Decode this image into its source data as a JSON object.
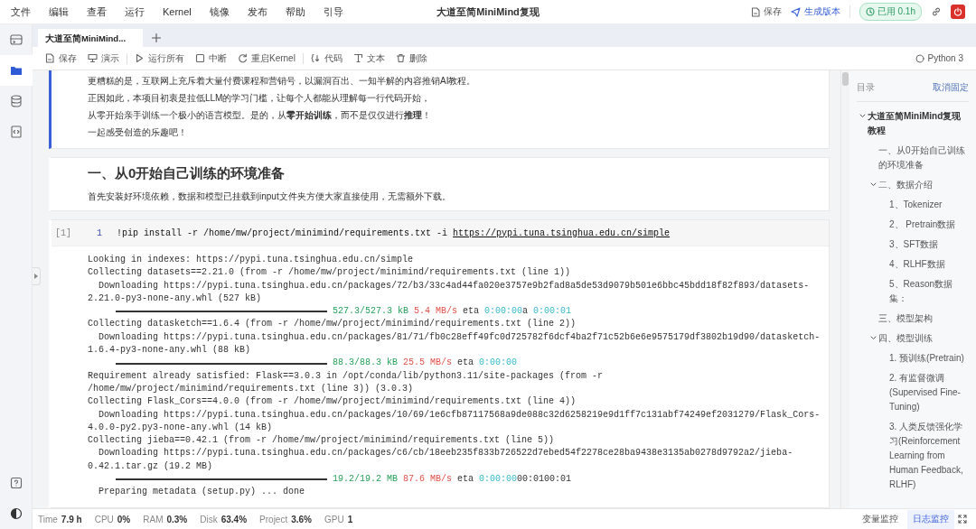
{
  "menu": [
    "文件",
    "编辑",
    "查看",
    "运行",
    "Kernel",
    "镜像",
    "发布",
    "帮助",
    "引导"
  ],
  "window": {
    "title": "大道至简MiniMind复现"
  },
  "header_actions": {
    "save": "保存",
    "publish": "生成版本",
    "usage": "已用 0.1h"
  },
  "rail": [
    {
      "selected": false
    },
    {
      "selected": true
    },
    {
      "selected": false
    },
    {
      "selected": false
    }
  ],
  "tabs": [
    {
      "label": "大道至简MiniMind...",
      "selected": true
    }
  ],
  "toolbar": {
    "groups": [
      [
        "保存",
        "演示"
      ],
      [
        "运行所有",
        "中断",
        "重启Kernel"
      ],
      [
        "代码",
        "文本",
        "删除"
      ]
    ],
    "kernel": "Python 3"
  },
  "cells": [
    {
      "kind": "markdown",
      "selected": true,
      "paragraphs": [
        "更糟糕的是，互联网上充斥着大量付费课程和营销号，以漏洞百出、一知半解的内容推销AI教程。",
        "正因如此，本项目初衷是拉低LLM的学习门槛，让每个人都能从理解每一行代码开始，",
        "从零开始亲手训练一个极小的语言模型。是的，从**零开始训练**，而不是仅仅进行**推理**！",
        "一起感受创造的乐趣吧！"
      ]
    },
    {
      "kind": "markdown",
      "selected": false,
      "heading": "一、从0开始自己训练的环境准备",
      "paragraphs": [
        "首先安装好环境依赖，数据和模型已挂载到input文件夹方便大家直接使用，无需额外下载。"
      ]
    },
    {
      "kind": "code",
      "selected": false,
      "prompt": "[1]",
      "line_number": "1",
      "code": "!pip install -r /home/mw/project/minimind/requirements.txt -i ",
      "code_link": "https://pypi.tuna.tsinghua.edu.cn/simple",
      "output": [
        {
          "kind": "text",
          "text": "Looking in indexes: https://pypi.tuna.tsinghua.edu.cn/simple"
        },
        {
          "kind": "text",
          "text": "Collecting datasets==2.21.0 (from -r /home/mw/project/minimind/requirements.txt (line 1))"
        },
        {
          "kind": "text",
          "text": "  Downloading https://pypi.tuna.tsinghua.edu.cn/packages/72/b3/33c4ad44fa020e3757e9b2fad8a5de53d9079b501e6bbc45bdd18f82f893/datasets-"
        },
        {
          "kind": "text",
          "text": "2.21.0-py3-none-any.whl (527 kB)"
        },
        {
          "kind": "progress",
          "level": 1,
          "parts": [
            {
              "kind": "size",
              "text": "527.3/527.3 kB"
            },
            {
              "kind": "rate",
              "text": "5.4 MB/s"
            },
            {
              "kind": "plain",
              "text": "eta"
            },
            {
              "kind": "eta",
              "text": "0:00:00"
            },
            {
              "kind": "glued",
              "text": "a"
            },
            {
              "kind": "eta",
              "text": "0:00:01"
            }
          ]
        },
        {
          "kind": "text",
          "text": "Collecting datasketch==1.6.4 (from -r /home/mw/project/minimind/requirements.txt (line 2))"
        },
        {
          "kind": "text",
          "text": "  Downloading https://pypi.tuna.tsinghua.edu.cn/packages/81/71/fb0c28eff49fc0d725782f6dcf4ba2f71c52b6e6e9575179df3802b19d90/datasketch-"
        },
        {
          "kind": "text",
          "text": "1.6.4-py3-none-any.whl (88 kB)"
        },
        {
          "kind": "progress",
          "level": 1,
          "parts": [
            {
              "kind": "size",
              "text": "88.3/88.3 kB"
            },
            {
              "kind": "rate",
              "text": "25.5 MB/s"
            },
            {
              "kind": "plain",
              "text": "eta"
            },
            {
              "kind": "eta",
              "text": "0:00:00"
            }
          ]
        },
        {
          "kind": "text",
          "text": "Requirement already satisfied: Flask==3.0.3 in /opt/conda/lib/python3.11/site-packages (from -r"
        },
        {
          "kind": "text",
          "text": "/home/mw/project/minimind/requirements.txt (line 3)) (3.0.3)"
        },
        {
          "kind": "text",
          "text": "Collecting Flask_Cors==4.0.0 (from -r /home/mw/project/minimind/requirements.txt (line 4))"
        },
        {
          "kind": "text",
          "text": "  Downloading https://pypi.tuna.tsinghua.edu.cn/packages/10/69/1e6cfb87117568a9de088c32d6258219e9d1ff7c131abf74249ef2031279/Flask_Cors-"
        },
        {
          "kind": "text",
          "text": "4.0.0-py2.py3-none-any.whl (14 kB)"
        },
        {
          "kind": "text",
          "text": "Collecting jieba==0.42.1 (from -r /home/mw/project/minimind/requirements.txt (line 5))"
        },
        {
          "kind": "text",
          "text": "  Downloading https://pypi.tuna.tsinghua.edu.cn/packages/c6/cb/18eeb235f833b726522d7ebed54f2278ce28ba9438e3135ab0278d9792a2/jieba-"
        },
        {
          "kind": "text",
          "text": "0.42.1.tar.gz (19.2 MB)"
        },
        {
          "kind": "progress",
          "level": 1,
          "parts": [
            {
              "kind": "size",
              "text": "19.2/19.2 MB"
            },
            {
              "kind": "rate",
              "text": "87.6 MB/s"
            },
            {
              "kind": "plain",
              "text": "eta"
            },
            {
              "kind": "eta",
              "text": "0:00:00"
            },
            {
              "kind": "glued",
              "text": "00:0100:01"
            }
          ]
        },
        {
          "kind": "text",
          "text": "  Preparing metadata (setup.py) ... done"
        }
      ]
    }
  ],
  "toc": {
    "title": "目录",
    "unpin": "取消固定",
    "items": [
      {
        "label": "大道至简MiniMind复现教程",
        "expanded": true,
        "children": [
          {
            "label": "一、从0开始自己训练的环境准备"
          },
          {
            "label": "二、数据介绍",
            "expanded": true,
            "children": [
              {
                "label": "1、Tokenizer"
              },
              {
                "label": "2、 Pretrain数据"
              },
              {
                "label": "3、SFT数据"
              },
              {
                "label": "4、RLHF数据"
              },
              {
                "label": "5、Reason数据集："
              }
            ]
          },
          {
            "label": "三、模型架构"
          },
          {
            "label": "四、模型训练",
            "expanded": true,
            "children": [
              {
                "label": "1. 预训练(Pretrain)"
              },
              {
                "label": "2. 有监督微调(Supervised Fine-Tuning)"
              },
              {
                "label": "3. 人类反馈强化学习(Reinforcement Learning from Human Feedback, RLHF)"
              }
            ]
          }
        ]
      }
    ]
  },
  "status_bar": {
    "metrics": [
      {
        "label": "Time",
        "value": "7.9 h"
      },
      {
        "label": "CPU",
        "value": "0%"
      },
      {
        "label": "RAM",
        "value": "0.3%"
      },
      {
        "label": "Disk",
        "value": "63.4%"
      },
      {
        "label": "Project",
        "value": "3.6%"
      },
      {
        "label": "GPU",
        "value": "1"
      }
    ],
    "monitors": [
      {
        "label": "变量监控",
        "selected": false
      },
      {
        "label": "日志监控",
        "selected": true
      }
    ]
  }
}
